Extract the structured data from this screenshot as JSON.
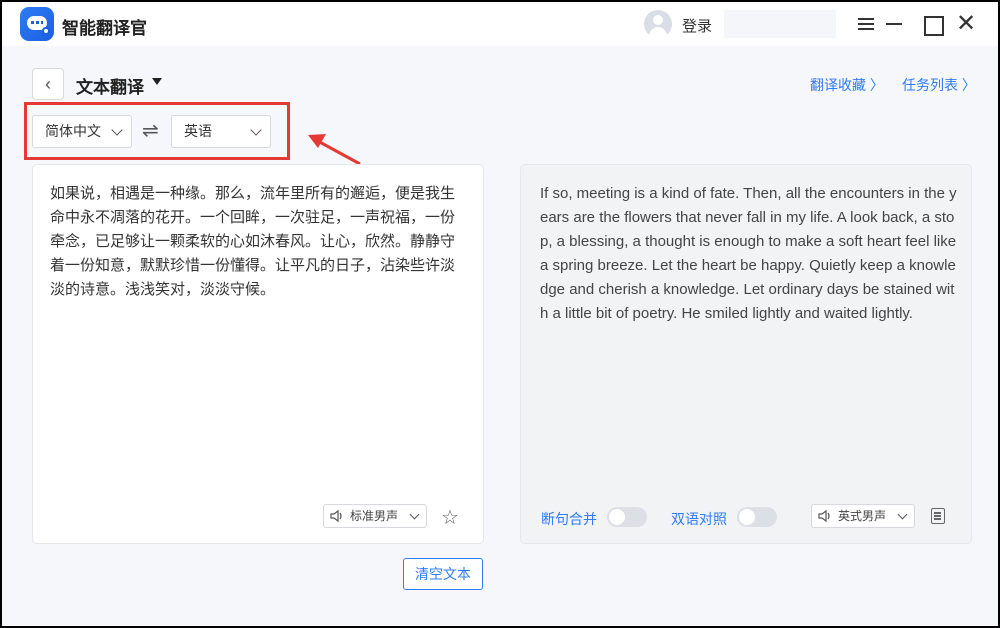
{
  "app": {
    "name": "智能翻译官",
    "login_label": "登录"
  },
  "header": {
    "title": "文本翻译",
    "links": [
      {
        "label": "翻译收藏 〉"
      },
      {
        "label": "任务列表 〉"
      }
    ]
  },
  "languages": {
    "source": "简体中文",
    "target": "英语",
    "swap_icon": "⇌"
  },
  "source_panel": {
    "text": "如果说，相遇是一种缘。那么，流年里所有的邂逅，便是我生命中永不凋落的花开。一个回眸，一次驻足，一声祝福，一份牵念，已足够让一颗柔软的心如沐春风。让心，欣然。静静守着一份知意，默默珍惜一份懂得。让平凡的日子，沾染些许淡淡的诗意。浅浅笑对，淡淡守候。",
    "voice": "标准男声"
  },
  "target_panel": {
    "text": "If so, meeting is a kind of fate. Then, all the encounters in the years are the flowers that never fall in my life. A look back, a stop, a blessing, a thought is enough to make a soft heart feel like a spring breeze. Let the heart be happy. Quietly keep a knowledge and cherish a knowledge. Let ordinary days be stained with a little bit of poetry. He smiled lightly and waited lightly.",
    "merge_label": "断句合并",
    "bilingual_label": "双语对照",
    "voice": "英式男声"
  },
  "clear_button": "清空文本",
  "colors": {
    "accent": "#2f7cf6",
    "highlight_box": "#e53935"
  }
}
